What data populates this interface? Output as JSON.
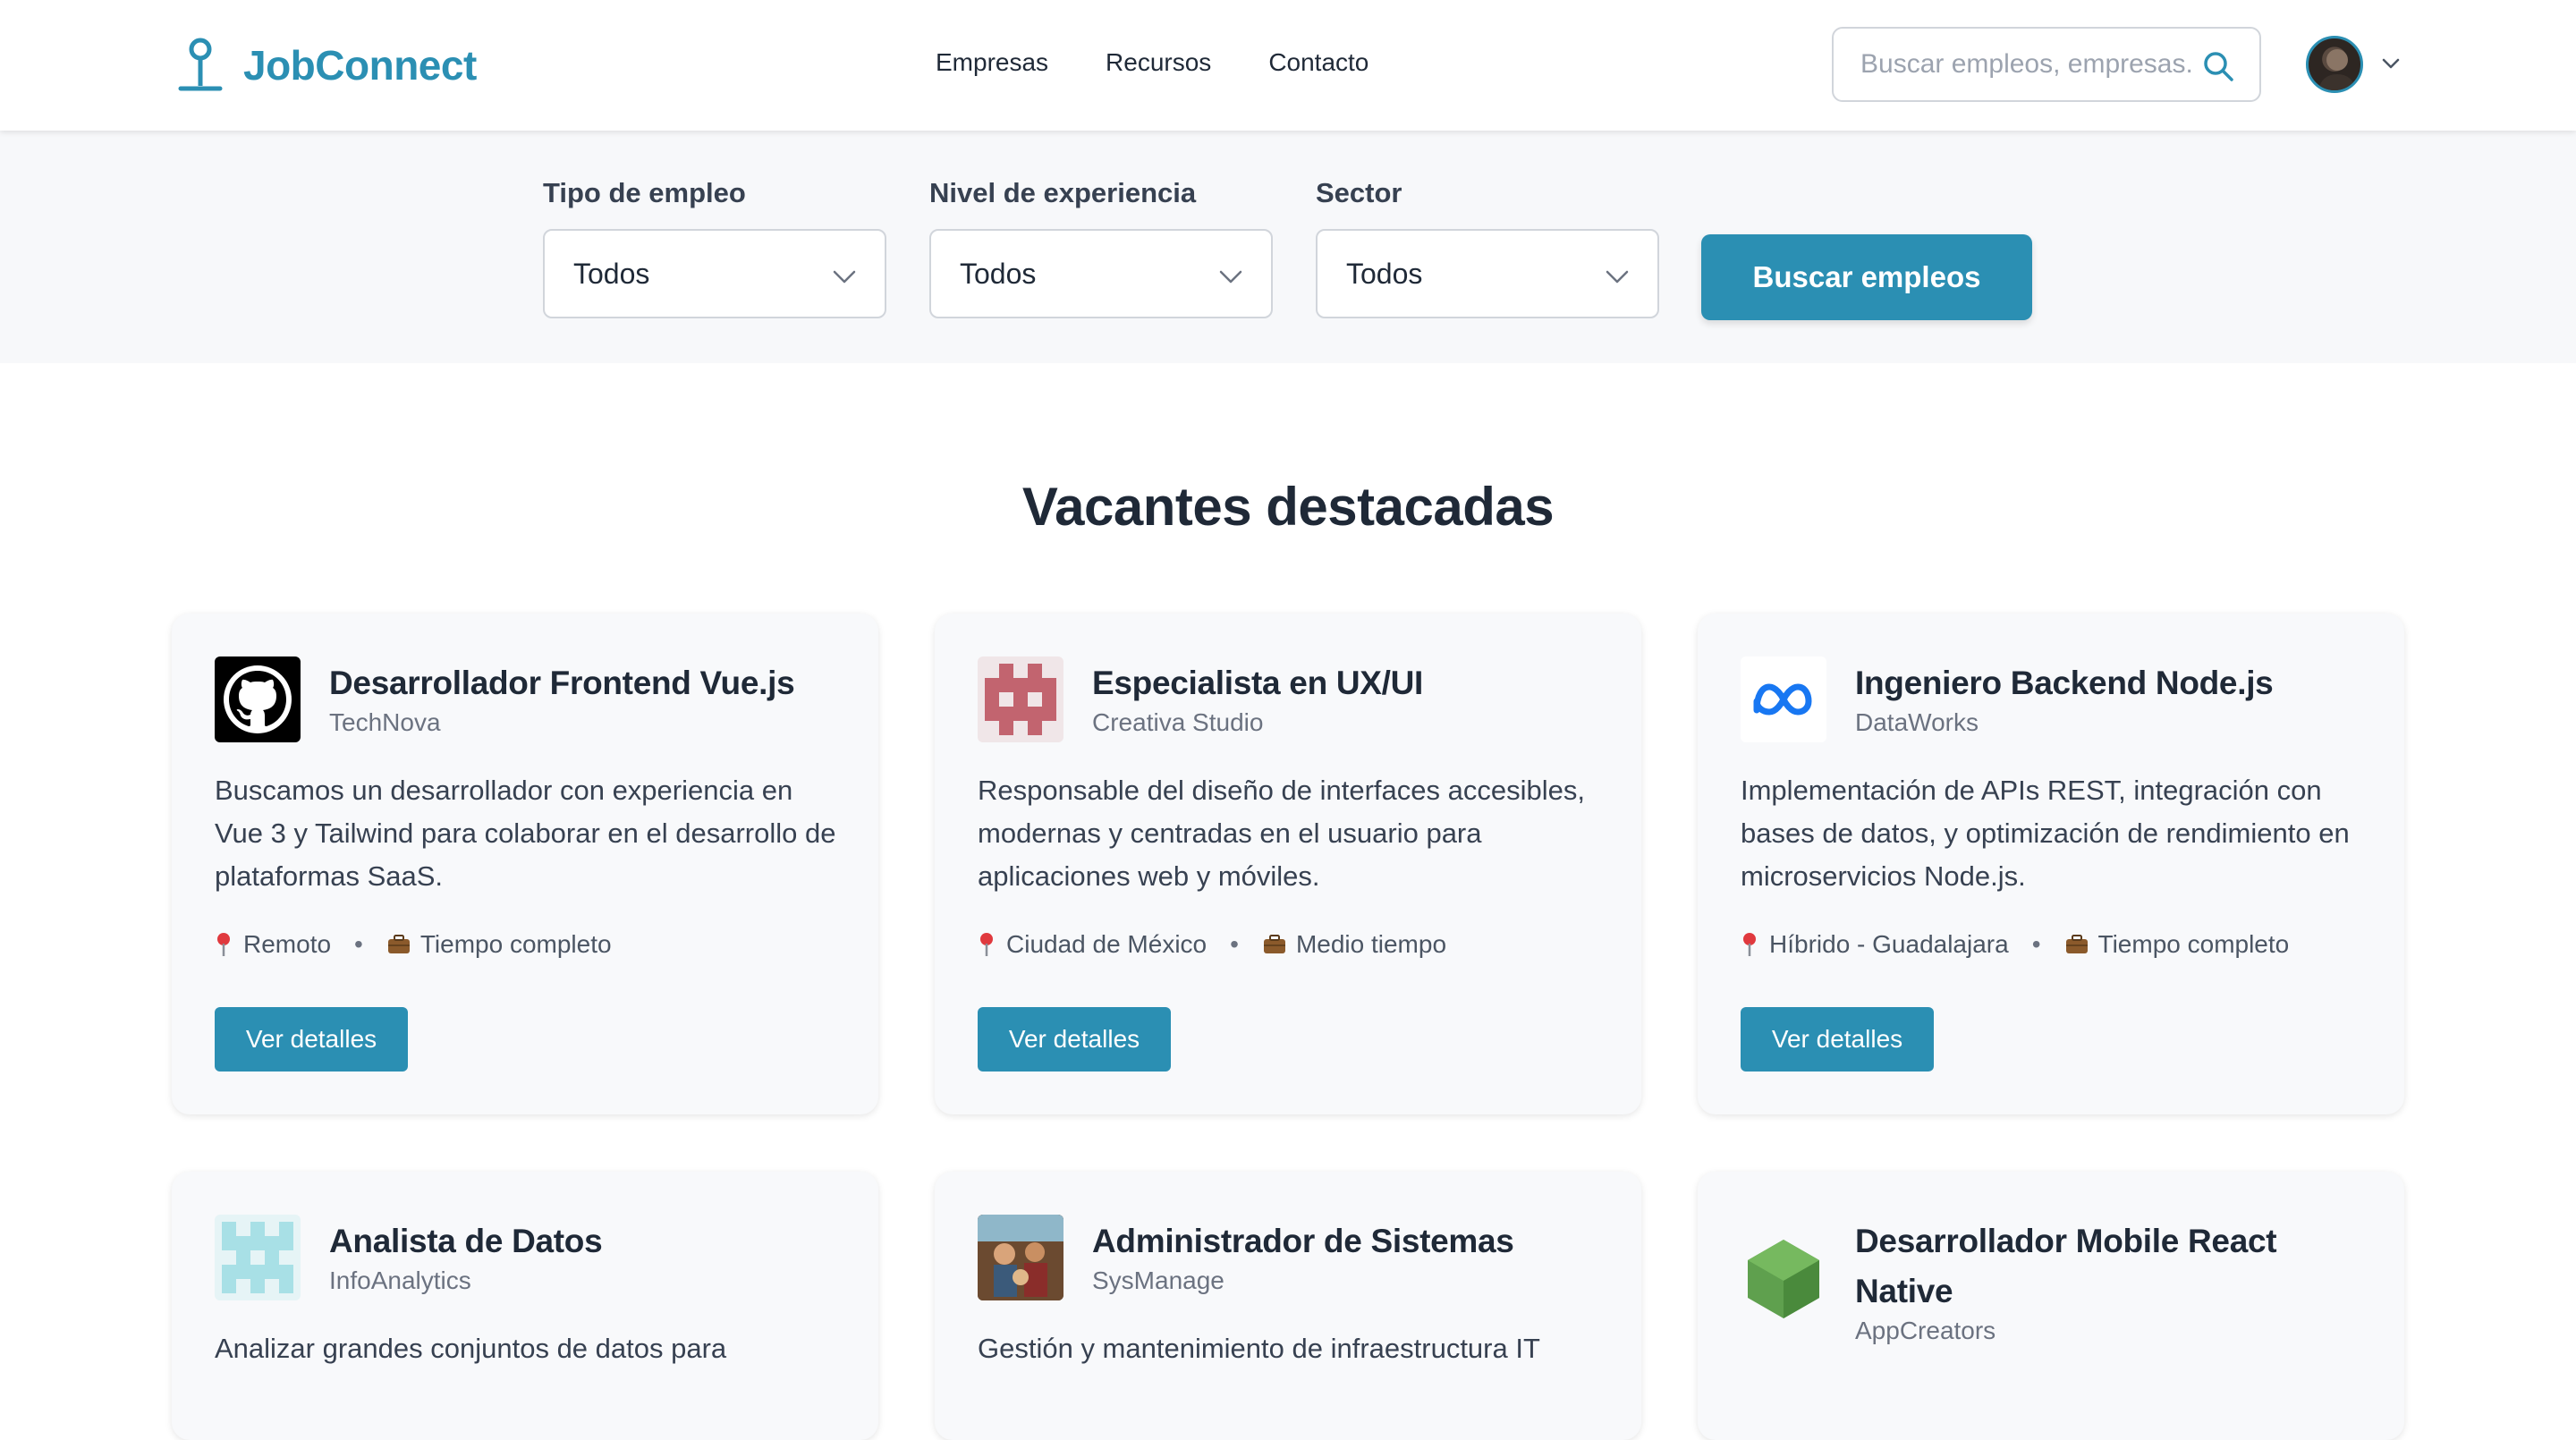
{
  "header": {
    "brand": "JobConnect",
    "nav": [
      "Empresas",
      "Recursos",
      "Contacto"
    ],
    "search_placeholder": "Buscar empleos, empresas..."
  },
  "filters": {
    "job_type": {
      "label": "Tipo de empleo",
      "value": "Todos"
    },
    "experience": {
      "label": "Nivel de experiencia",
      "value": "Todos"
    },
    "sector": {
      "label": "Sector",
      "value": "Todos"
    },
    "search_button": "Buscar empleos"
  },
  "section_title": "Vacantes destacadas",
  "jobs": [
    {
      "title": "Desarrollador Frontend Vue.js",
      "company": "TechNova",
      "description": "Buscamos un desarrollador con experiencia en Vue 3 y Tailwind para colaborar en el desarrollo de plataformas SaaS.",
      "location": "Remoto",
      "type": "Tiempo completo",
      "button": "Ver detalles",
      "logo": "github-logo"
    },
    {
      "title": "Especialista en UX/UI",
      "company": "Creativa Studio",
      "description": "Responsable del diseño de interfaces accesibles, modernas y centradas en el usuario para aplicaciones web y móviles.",
      "location": "Ciudad de México",
      "type": "Medio tiempo",
      "button": "Ver detalles",
      "logo": "pixel-pattern-logo"
    },
    {
      "title": "Ingeniero Backend Node.js",
      "company": "DataWorks",
      "description": "Implementación de APIs REST, integración con bases de datos, y optimización de rendimiento en microservicios Node.js.",
      "location": "Híbrido - Guadalajara",
      "type": "Tiempo completo",
      "button": "Ver detalles",
      "logo": "meta-logo"
    },
    {
      "title": "Analista de Datos",
      "company": "InfoAnalytics",
      "description": "Analizar grandes conjuntos de datos para",
      "logo": "pixel-pattern-logo"
    },
    {
      "title": "Administrador de Sistemas",
      "company": "SysManage",
      "description": "Gestión y mantenimiento de infraestructura IT",
      "logo": "illustration-logo"
    },
    {
      "title": "Desarrollador Mobile React Native",
      "company": "AppCreators",
      "logo": "nodejs-hexagon-logo"
    }
  ],
  "colors": {
    "accent": "#2b8fb3",
    "filter_bg": "#f7f8fa",
    "card_bg": "#f8f9fb"
  }
}
